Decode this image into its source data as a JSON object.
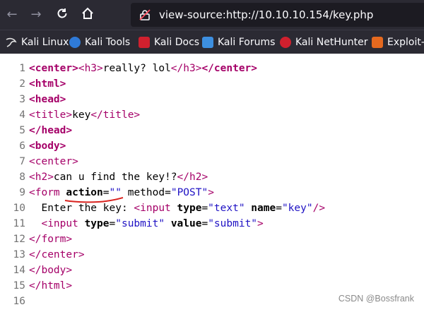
{
  "browser": {
    "url": "view-source:http://10.10.10.154/key.php",
    "bookmarks": [
      {
        "label": "Kali Linux",
        "icon": "kali-dragon-icon"
      },
      {
        "label": "Kali Tools",
        "icon": "kali-tools-icon"
      },
      {
        "label": "Kali Docs",
        "icon": "kali-docs-icon"
      },
      {
        "label": "Kali Forums",
        "icon": "kali-forums-icon"
      },
      {
        "label": "Kali NetHunter",
        "icon": "kali-nethunter-icon"
      },
      {
        "label": "Exploit-D",
        "icon": "exploit-db-icon"
      }
    ]
  },
  "source": {
    "lines": [
      {
        "n": "1",
        "tokens": [
          [
            "t",
            "<center>"
          ],
          [
            "x",
            "<h3>"
          ],
          [
            "p",
            "really? lol"
          ],
          [
            "x",
            "</h3>"
          ],
          [
            "t",
            "</center>"
          ]
        ]
      },
      {
        "n": "2",
        "tokens": [
          [
            "t",
            "<html>"
          ]
        ]
      },
      {
        "n": "3",
        "tokens": [
          [
            "t",
            "<head>"
          ]
        ]
      },
      {
        "n": "4",
        "tokens": [
          [
            "x",
            "<title>"
          ],
          [
            "p",
            "key"
          ],
          [
            "x",
            "</title>"
          ]
        ]
      },
      {
        "n": "5",
        "tokens": [
          [
            "t",
            "</head>"
          ]
        ]
      },
      {
        "n": "6",
        "tokens": [
          [
            "t",
            "<body>"
          ]
        ]
      },
      {
        "n": "7",
        "tokens": [
          [
            "x",
            "<center>"
          ]
        ]
      },
      {
        "n": "8",
        "tokens": [
          [
            "x",
            "<h2>"
          ],
          [
            "p",
            "can u find the key!?"
          ],
          [
            "x",
            "</h2>"
          ]
        ]
      },
      {
        "n": "9",
        "tokens": [
          [
            "x",
            "<form "
          ],
          [
            "a",
            "action"
          ],
          [
            "p",
            "="
          ],
          [
            "v",
            "\"\""
          ],
          [
            "p",
            " "
          ],
          [
            "a2",
            "method"
          ],
          [
            "p",
            "="
          ],
          [
            "v",
            "\"POST\""
          ],
          [
            "x",
            ">"
          ]
        ]
      },
      {
        "n": "10",
        "tokens": [
          [
            "p",
            "  Enter the key: "
          ],
          [
            "x",
            "<input "
          ],
          [
            "a",
            "type"
          ],
          [
            "p",
            "="
          ],
          [
            "v",
            "\"text\""
          ],
          [
            "p",
            " "
          ],
          [
            "a",
            "name"
          ],
          [
            "p",
            "="
          ],
          [
            "v",
            "\"key\""
          ],
          [
            "x",
            "/>"
          ]
        ]
      },
      {
        "n": "11",
        "tokens": [
          [
            "p",
            "  "
          ],
          [
            "x",
            "<input "
          ],
          [
            "a",
            "type"
          ],
          [
            "p",
            "="
          ],
          [
            "v",
            "\"submit\""
          ],
          [
            "p",
            " "
          ],
          [
            "a",
            "value"
          ],
          [
            "p",
            "="
          ],
          [
            "v",
            "\"submit\""
          ],
          [
            "x",
            ">"
          ]
        ]
      },
      {
        "n": "12",
        "tokens": [
          [
            "x",
            "</form>"
          ]
        ]
      },
      {
        "n": "13",
        "tokens": [
          [
            "x",
            "</center>"
          ]
        ]
      },
      {
        "n": "14",
        "tokens": [
          [
            "x",
            "</body>"
          ]
        ]
      },
      {
        "n": "15",
        "tokens": [
          [
            "x",
            "</html>"
          ]
        ]
      },
      {
        "n": "16",
        "tokens": []
      }
    ]
  },
  "watermark": "CSDN @Bossfrank"
}
